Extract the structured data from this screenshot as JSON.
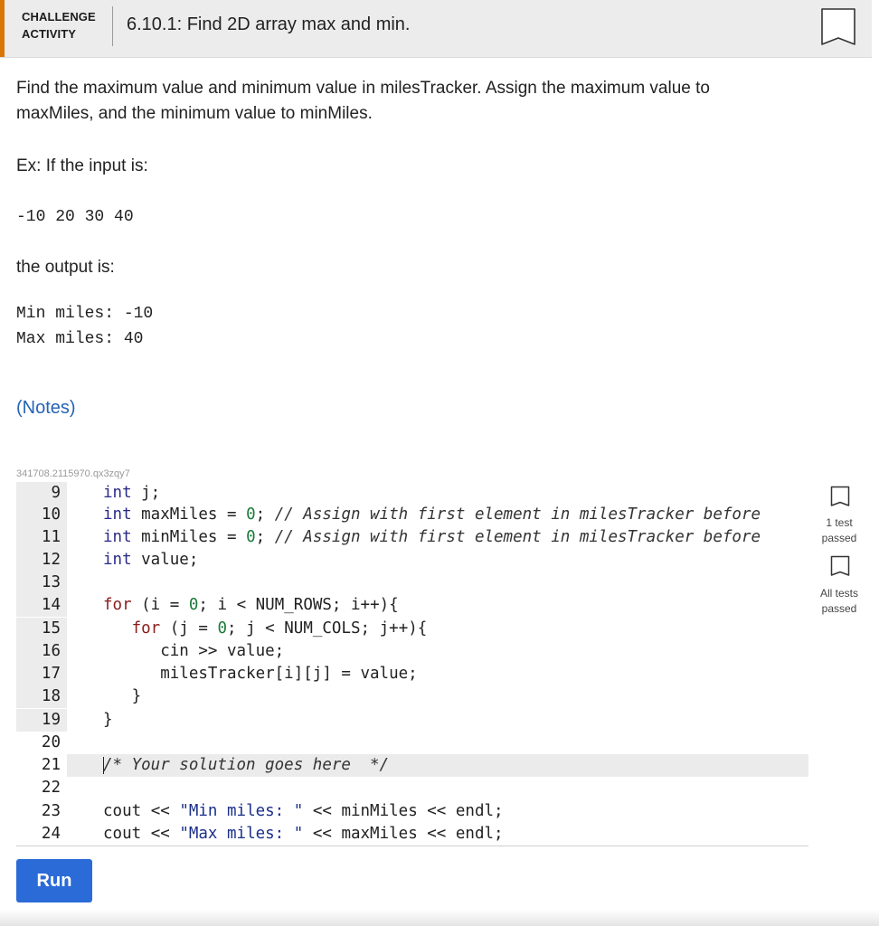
{
  "header": {
    "badge_line1": "CHALLENGE",
    "badge_line2": "ACTIVITY",
    "title": "6.10.1: Find 2D array max and min.",
    "accent_color": "#d97706"
  },
  "description": {
    "line1": "Find the maximum value and minimum value in milesTracker. Assign the maximum value to",
    "line2": "maxMiles, and the minimum value to minMiles.",
    "example_intro": "Ex: If the input is:",
    "example_input": "-10 20 30 40",
    "output_intro": "the output is:",
    "example_output_line1": "Min miles: -10",
    "example_output_line2": "Max miles: 40"
  },
  "notes_link": "(Notes)",
  "code_id": "341708.2115970.qx3zqy7",
  "editor": {
    "lines": [
      {
        "num": "9",
        "tokens": [
          [
            "int",
            "kwb"
          ],
          [
            " j;",
            ""
          ]
        ]
      },
      {
        "num": "10",
        "tokens": [
          [
            "int",
            "kwb"
          ],
          [
            " maxMiles ",
            ""
          ],
          [
            "=",
            ""
          ],
          [
            " ",
            ""
          ],
          [
            "0",
            "num"
          ],
          [
            "; ",
            ""
          ],
          [
            "// Assign with first element in milesTracker before",
            "com"
          ]
        ]
      },
      {
        "num": "11",
        "tokens": [
          [
            "int",
            "kwb"
          ],
          [
            " minMiles ",
            ""
          ],
          [
            "=",
            ""
          ],
          [
            " ",
            ""
          ],
          [
            "0",
            "num"
          ],
          [
            "; ",
            ""
          ],
          [
            "// Assign with first element in milesTracker before",
            "com"
          ]
        ]
      },
      {
        "num": "12",
        "tokens": [
          [
            "int",
            "kwb"
          ],
          [
            " value;",
            ""
          ]
        ]
      },
      {
        "num": "13",
        "tokens": []
      },
      {
        "num": "14",
        "tokens": [
          [
            "for",
            "kw"
          ],
          [
            " (i ",
            ""
          ],
          [
            "=",
            ""
          ],
          [
            " ",
            ""
          ],
          [
            "0",
            "num"
          ],
          [
            "; i ",
            ""
          ],
          [
            "<",
            ""
          ],
          [
            " NUM_ROWS; i",
            ""
          ],
          [
            "++",
            ""
          ],
          [
            "){",
            ""
          ]
        ]
      },
      {
        "num": "15",
        "tokens": [
          [
            "   ",
            ""
          ],
          [
            "for",
            "kw"
          ],
          [
            " (j ",
            ""
          ],
          [
            "=",
            ""
          ],
          [
            " ",
            ""
          ],
          [
            "0",
            "num"
          ],
          [
            "; j ",
            ""
          ],
          [
            "<",
            ""
          ],
          [
            " NUM_COLS; j",
            ""
          ],
          [
            "++",
            ""
          ],
          [
            "){",
            ""
          ]
        ]
      },
      {
        "num": "16",
        "tokens": [
          [
            "      cin ",
            ""
          ],
          [
            ">>",
            ""
          ],
          [
            " value;",
            ""
          ]
        ]
      },
      {
        "num": "17",
        "tokens": [
          [
            "      milesTracker[i][j] ",
            ""
          ],
          [
            "=",
            ""
          ],
          [
            " value;",
            ""
          ]
        ]
      },
      {
        "num": "18",
        "tokens": [
          [
            "   }",
            ""
          ]
        ]
      },
      {
        "num": "19",
        "tokens": [
          [
            "}",
            ""
          ]
        ]
      },
      {
        "num": "20",
        "tokens": []
      },
      {
        "num": "21",
        "tokens": [
          [
            "/* Your solution goes here  */",
            "com"
          ]
        ],
        "active": true
      },
      {
        "num": "22",
        "tokens": []
      },
      {
        "num": "23",
        "tokens": [
          [
            "cout ",
            ""
          ],
          [
            "<<",
            ""
          ],
          [
            " ",
            ""
          ],
          [
            "\"Min miles: \"",
            "str"
          ],
          [
            " ",
            ""
          ],
          [
            "<<",
            ""
          ],
          [
            " minMiles ",
            ""
          ],
          [
            "<<",
            ""
          ],
          [
            " endl;",
            ""
          ]
        ]
      },
      {
        "num": "24",
        "tokens": [
          [
            "cout ",
            ""
          ],
          [
            "<<",
            ""
          ],
          [
            " ",
            ""
          ],
          [
            "\"Max miles: \"",
            "str"
          ],
          [
            " ",
            ""
          ],
          [
            "<<",
            ""
          ],
          [
            " maxMiles ",
            ""
          ],
          [
            "<<",
            ""
          ],
          [
            " endl;",
            ""
          ]
        ]
      }
    ]
  },
  "tests": {
    "test1_line1": "1 test",
    "test1_line2": "passed",
    "test2_line1": "All tests",
    "test2_line2": "passed"
  },
  "run_button": "Run"
}
